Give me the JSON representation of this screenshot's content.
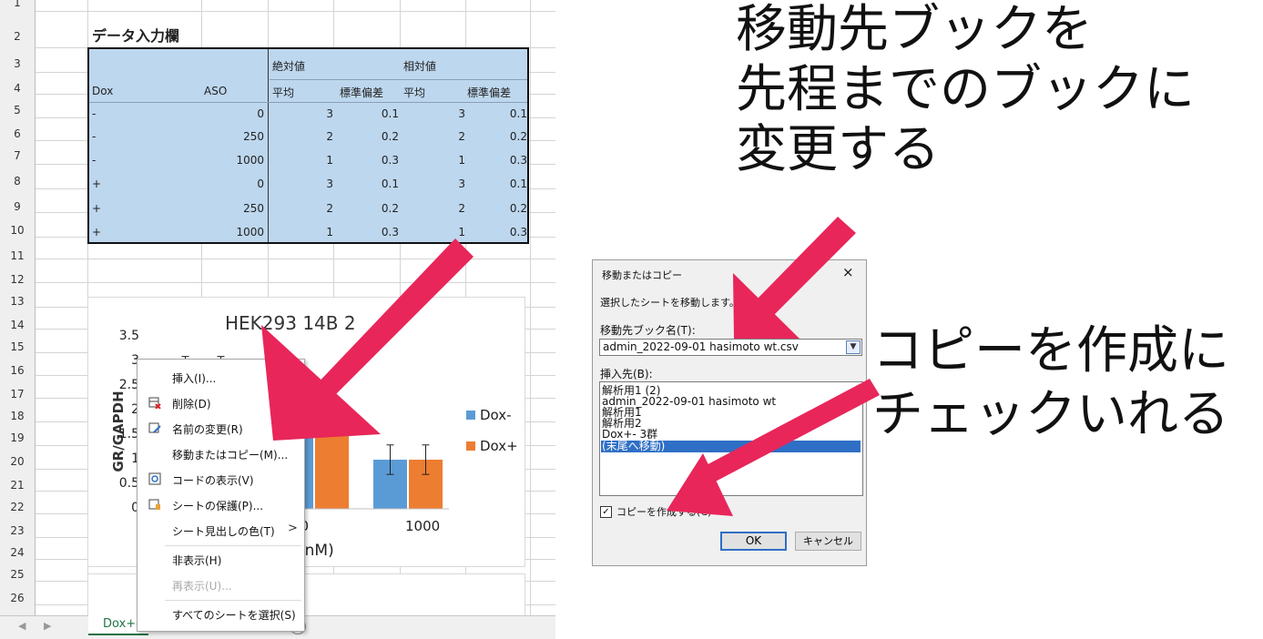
{
  "sheet": {
    "row_numbers": [
      "1",
      "2",
      "3",
      "4",
      "5",
      "6",
      "7",
      "8",
      "9",
      "10",
      "11",
      "12",
      "13",
      "14",
      "15",
      "16",
      "17",
      "18",
      "19",
      "20",
      "21",
      "22",
      "23",
      "24",
      "25",
      "26"
    ],
    "title": "データ入力欄",
    "header_abs": "絶対値",
    "header_rel": "相対値",
    "col_dox": "Dox",
    "col_aso": "ASO",
    "col_mean1": "平均",
    "col_sd1": "標準偏差",
    "col_mean2": "平均",
    "col_sd2": "標準偏差",
    "rows": [
      {
        "dox": "-",
        "aso": "0",
        "m1": "3",
        "s1": "0.1",
        "m2": "3",
        "s2": "0.1"
      },
      {
        "dox": "-",
        "aso": "250",
        "m1": "2",
        "s1": "0.2",
        "m2": "2",
        "s2": "0.2"
      },
      {
        "dox": "-",
        "aso": "1000",
        "m1": "1",
        "s1": "0.3",
        "m2": "1",
        "s2": "0.3"
      },
      {
        "dox": "+",
        "aso": "0",
        "m1": "3",
        "s1": "0.1",
        "m2": "3",
        "s2": "0.1"
      },
      {
        "dox": "+",
        "aso": "250",
        "m1": "2",
        "s1": "0.2",
        "m2": "2",
        "s2": "0.2"
      },
      {
        "dox": "+",
        "aso": "1000",
        "m1": "1",
        "s1": "0.3",
        "m2": "1",
        "s2": "0.3"
      }
    ],
    "tabs": [
      "Dox+-"
    ]
  },
  "chart_data": {
    "type": "bar",
    "title": "HEK293 14B 2",
    "ylabel": "GR/GAPDH",
    "xlabel": "(nM)",
    "y_ticks": [
      "3.5",
      "3",
      "2.5",
      "2",
      "1.5",
      "1",
      "0.5",
      "0"
    ],
    "categories": [
      "0",
      "250",
      "1000"
    ],
    "visible_category_labels": [
      "50",
      "1000"
    ],
    "series": [
      {
        "name": "Dox-",
        "values": [
          3,
          2,
          1
        ],
        "errors": [
          0.1,
          0.2,
          0.3
        ],
        "color": "#5b9bd5"
      },
      {
        "name": "Dox+",
        "values": [
          3,
          2,
          1
        ],
        "errors": [
          0.1,
          0.2,
          0.3
        ],
        "color": "#ed7d31"
      }
    ],
    "ylim": [
      0,
      3.5
    ],
    "legend": "right"
  },
  "context_menu": {
    "items": [
      {
        "label": "挿入(I)...",
        "icon": "none"
      },
      {
        "label": "削除(D)",
        "icon": "delete-sheet-icon"
      },
      {
        "label": "名前の変更(R)",
        "icon": "rename-icon"
      },
      {
        "label": "移動またはコピー(M)...",
        "icon": "none"
      },
      {
        "label": "コードの表示(V)",
        "icon": "view-code-icon"
      },
      {
        "label": "シートの保護(P)...",
        "icon": "protect-sheet-icon"
      },
      {
        "label": "シート見出しの色(T)",
        "icon": "none",
        "submenu": ">"
      },
      {
        "label": "非表示(H)",
        "icon": "none"
      },
      {
        "label": "再表示(U)...",
        "icon": "none",
        "disabled": true
      },
      {
        "label": "すべてのシートを選択(S)",
        "icon": "none"
      }
    ]
  },
  "dialog": {
    "title": "移動またはコピー",
    "close": "×",
    "instruction": "選択したシートを移動します。",
    "dest_label": "移動先ブック名(T):",
    "dest_value": "admin_2022-09-01 hasimoto wt.csv",
    "insert_label": "挿入先(B):",
    "insert_items": [
      "解析用1 (2)",
      "admin_2022-09-01 hasimoto wt",
      "解析用1",
      "解析用2",
      "Dox+- 3群",
      "(末尾へ移動)"
    ],
    "selected_index": 5,
    "copy_label": "コピーを作成する(C)",
    "copy_checked": true,
    "ok": "OK",
    "cancel": "キャンセル"
  },
  "callouts": {
    "top": [
      "移動先ブックを",
      "先程までのブックに",
      "変更する"
    ],
    "right": [
      "コピーを作成に",
      "チェックいれる"
    ]
  },
  "colors": {
    "arrow": "#e8265a",
    "table_fill": "#bdd7ee",
    "selection": "#2f6fc6",
    "accent": "#217346"
  }
}
